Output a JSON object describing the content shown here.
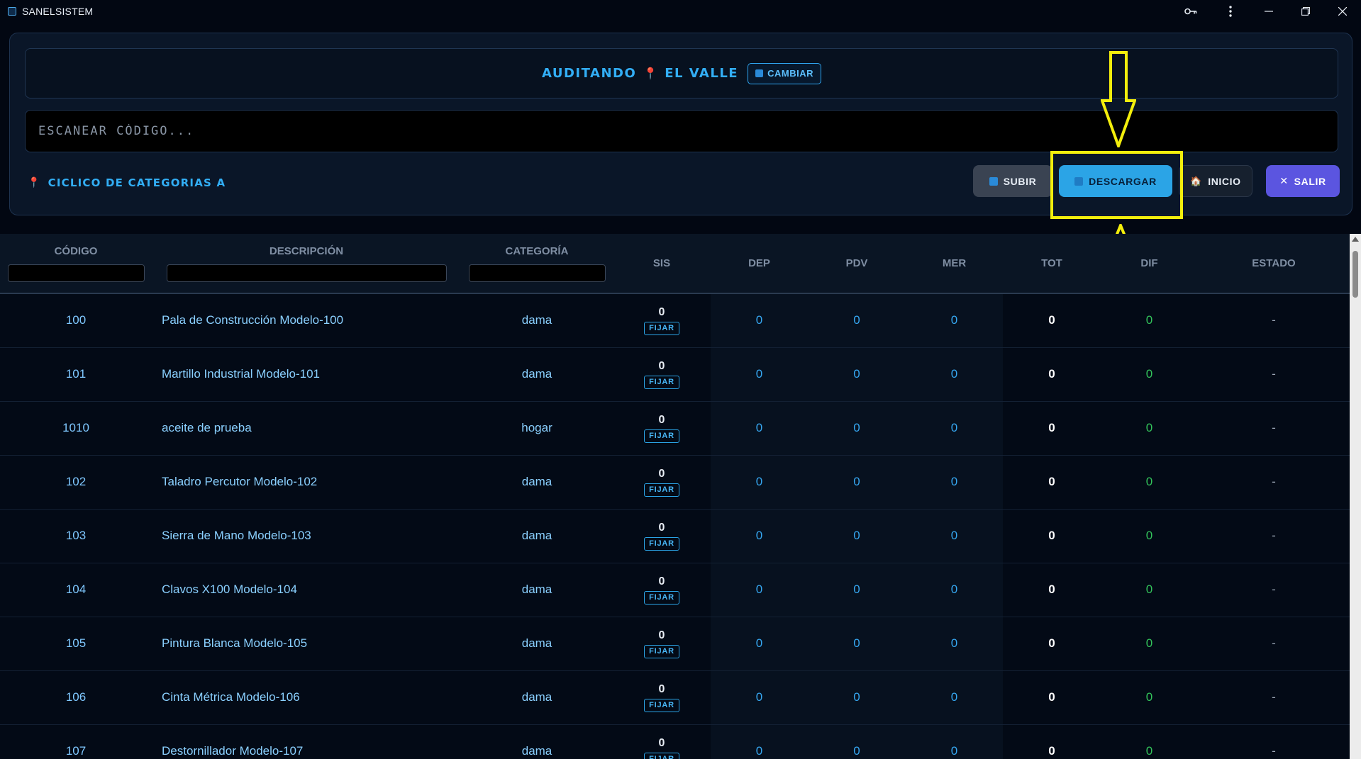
{
  "window": {
    "title": "SANELSISTEM"
  },
  "header": {
    "auditing_label": "AUDITANDO",
    "location": "EL VALLE",
    "change_button": "CAMBIAR"
  },
  "scan": {
    "placeholder": "ESCANEAR CÓDIGO..."
  },
  "cycle": {
    "label": "CICLICO DE CATEGORIAS A"
  },
  "actions": {
    "subir": "SUBIR",
    "descargar": "DESCARGAR",
    "inicio": "INICIO",
    "salir": "SALIR"
  },
  "colors": {
    "accent": "#2ba4e6",
    "highlight": "#f3ee0c",
    "salir": "#5b55e0",
    "dif": "#33c45b"
  },
  "table": {
    "columns": [
      "CÓDIGO",
      "DESCRIPCIÓN",
      "CATEGORÍA",
      "SIS",
      "DEP",
      "PDV",
      "MER",
      "TOT",
      "DIF",
      "ESTADO"
    ],
    "fix_label": "FIJAR",
    "rows": [
      {
        "code": "100",
        "desc": "Pala de Construcción Modelo-100",
        "cat": "dama",
        "sis": "0",
        "dep": "0",
        "pdv": "0",
        "mer": "0",
        "tot": "0",
        "dif": "0",
        "estado": "-"
      },
      {
        "code": "101",
        "desc": "Martillo Industrial Modelo-101",
        "cat": "dama",
        "sis": "0",
        "dep": "0",
        "pdv": "0",
        "mer": "0",
        "tot": "0",
        "dif": "0",
        "estado": "-"
      },
      {
        "code": "1010",
        "desc": "aceite de prueba",
        "cat": "hogar",
        "sis": "0",
        "dep": "0",
        "pdv": "0",
        "mer": "0",
        "tot": "0",
        "dif": "0",
        "estado": "-"
      },
      {
        "code": "102",
        "desc": "Taladro Percutor Modelo-102",
        "cat": "dama",
        "sis": "0",
        "dep": "0",
        "pdv": "0",
        "mer": "0",
        "tot": "0",
        "dif": "0",
        "estado": "-"
      },
      {
        "code": "103",
        "desc": "Sierra de Mano Modelo-103",
        "cat": "dama",
        "sis": "0",
        "dep": "0",
        "pdv": "0",
        "mer": "0",
        "tot": "0",
        "dif": "0",
        "estado": "-"
      },
      {
        "code": "104",
        "desc": "Clavos X100 Modelo-104",
        "cat": "dama",
        "sis": "0",
        "dep": "0",
        "pdv": "0",
        "mer": "0",
        "tot": "0",
        "dif": "0",
        "estado": "-"
      },
      {
        "code": "105",
        "desc": "Pintura Blanca Modelo-105",
        "cat": "dama",
        "sis": "0",
        "dep": "0",
        "pdv": "0",
        "mer": "0",
        "tot": "0",
        "dif": "0",
        "estado": "-"
      },
      {
        "code": "106",
        "desc": "Cinta Métrica Modelo-106",
        "cat": "dama",
        "sis": "0",
        "dep": "0",
        "pdv": "0",
        "mer": "0",
        "tot": "0",
        "dif": "0",
        "estado": "-"
      },
      {
        "code": "107",
        "desc": "Destornillador Modelo-107",
        "cat": "dama",
        "sis": "0",
        "dep": "0",
        "pdv": "0",
        "mer": "0",
        "tot": "0",
        "dif": "0",
        "estado": "-"
      }
    ]
  }
}
